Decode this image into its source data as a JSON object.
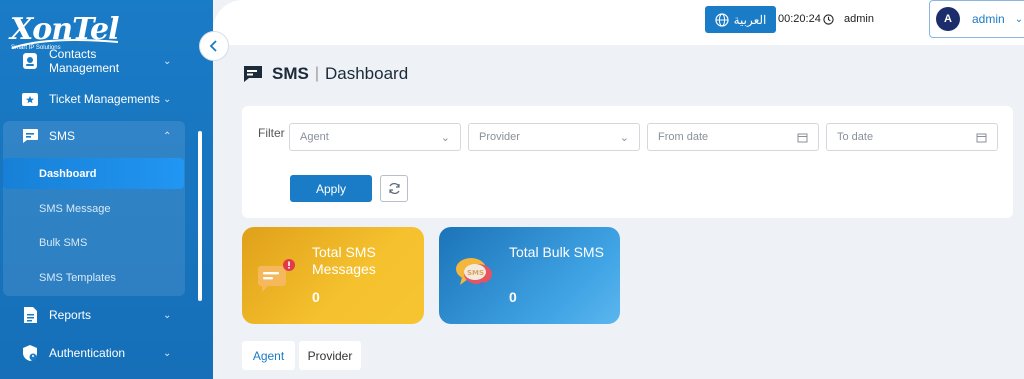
{
  "logo": {
    "text": "XonTel",
    "tagline": "Smart IP Solutions"
  },
  "sidebar": {
    "items": [
      {
        "label": "Contacts Management",
        "icon": "contacts-icon"
      },
      {
        "label": "Ticket Managements",
        "icon": "ticket-icon"
      },
      {
        "label": "SMS",
        "icon": "sms-icon"
      },
      {
        "label": "Reports",
        "icon": "reports-icon"
      },
      {
        "label": "Authentication",
        "icon": "authentication-icon"
      }
    ],
    "sms_sub": [
      {
        "label": "Dashboard",
        "active": true
      },
      {
        "label": "SMS Message"
      },
      {
        "label": "Bulk SMS"
      },
      {
        "label": "SMS Templates"
      }
    ]
  },
  "topbar": {
    "language_label": "العربية",
    "time": "00:20:24",
    "admin_label": "admin",
    "user": {
      "avatar_letter": "A",
      "name": "admin"
    }
  },
  "page": {
    "module": "SMS",
    "section": "Dashboard"
  },
  "filter": {
    "label": "Filter",
    "agent_placeholder": "Agent",
    "provider_placeholder": "Provider",
    "from_date_placeholder": "From date",
    "to_date_placeholder": "To date",
    "apply_label": "Apply"
  },
  "stats": [
    {
      "title": "Total SMS Messages",
      "value": "0",
      "color": "#f5c12e"
    },
    {
      "title": "Total Bulk SMS",
      "value": "0",
      "color": "#3fa3e4"
    }
  ],
  "tabs": [
    {
      "label": "Agent",
      "active": true
    },
    {
      "label": "Provider",
      "active": false
    }
  ],
  "colors": {
    "primary": "#1a7bc6",
    "sidebar": "#1a7bc6"
  }
}
